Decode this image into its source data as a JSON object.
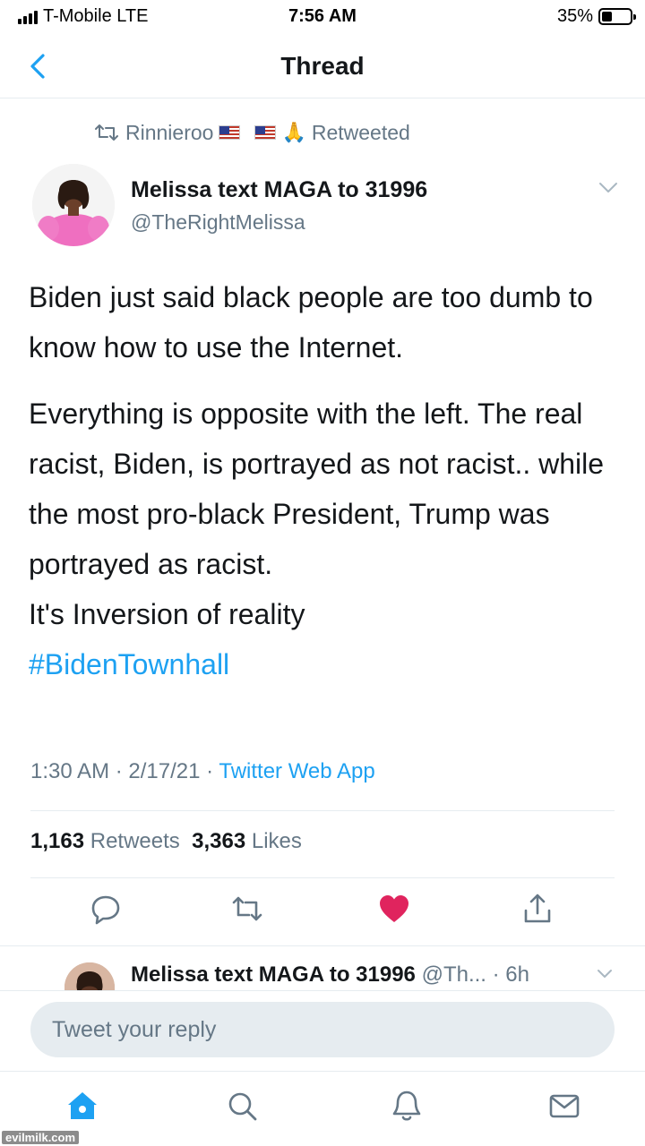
{
  "status_bar": {
    "carrier": "T-Mobile  LTE",
    "time": "7:56 AM",
    "battery_percent": "35%",
    "battery_level": 0.35
  },
  "nav": {
    "title": "Thread",
    "back_icon": "chevron-left-icon"
  },
  "retweet_context": {
    "retweeter": "Rinnieroo",
    "emoji": "🙏",
    "label": "Retweeted"
  },
  "tweet": {
    "author_name": "Melissa text MAGA to 31996",
    "author_handle": "@TheRightMelissa",
    "paragraph_1": "Biden just said black people are too dumb to know how to use the Internet.",
    "paragraph_2": "Everything is opposite with the left. The real racist, Biden, is portrayed as not racist.. while the most pro-black President, Trump was portrayed as racist.",
    "paragraph_3": "It's Inversion of reality",
    "hashtag": "#BidenTownhall",
    "timestamp": "1:30 AM · 2/17/21 · ",
    "source": "Twitter Web App",
    "retweets_count": "1,163",
    "retweets_label": "Retweets",
    "likes_count": "3,363",
    "likes_label": "Likes",
    "liked": true
  },
  "reply_preview": {
    "author_name": "Melissa text MAGA to 31996",
    "handle_time": "@Th... · 6h"
  },
  "composer": {
    "placeholder": "Tweet your reply"
  },
  "tabs": [
    {
      "icon": "home-icon",
      "active": true
    },
    {
      "icon": "search-icon",
      "active": false
    },
    {
      "icon": "notifications-icon",
      "active": false
    },
    {
      "icon": "messages-icon",
      "active": false
    }
  ],
  "watermark": "evilmilk.com",
  "colors": {
    "accent": "#1da1f2",
    "like": "#e0245e",
    "secondary_text": "#657786",
    "primary_text": "#14171a"
  }
}
